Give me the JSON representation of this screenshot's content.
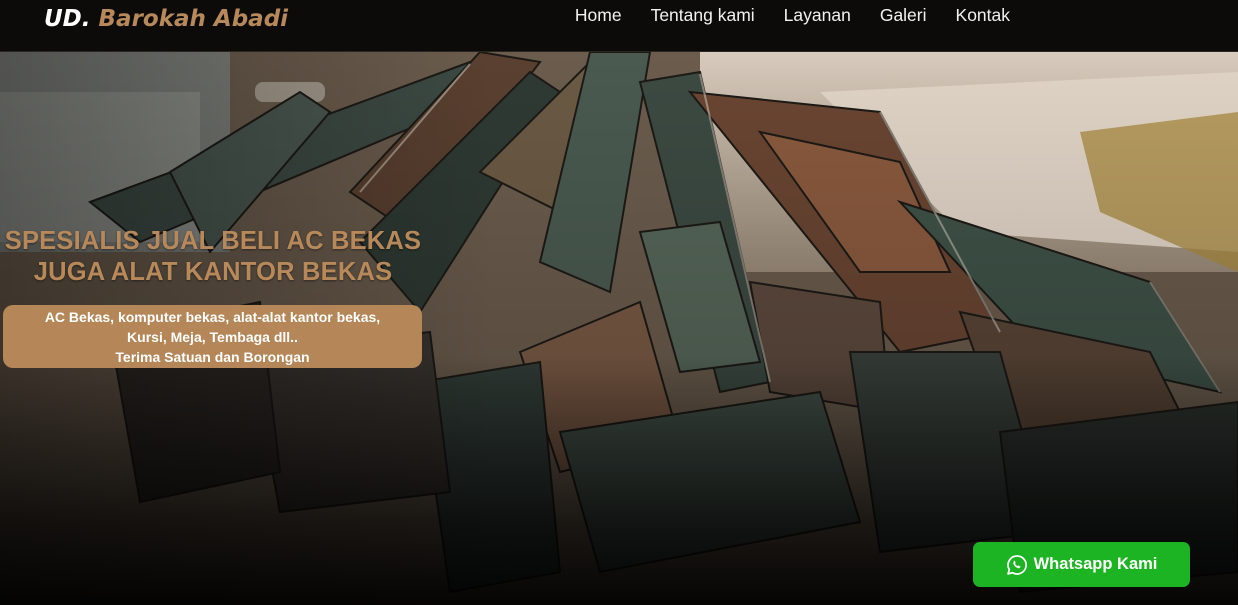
{
  "brand": {
    "prefix": "UD.",
    "name": "Barokah Abadi"
  },
  "nav": {
    "items": [
      {
        "label": "Home"
      },
      {
        "label": "Tentang kami"
      },
      {
        "label": "Layanan"
      },
      {
        "label": "Galeri"
      },
      {
        "label": "Kontak"
      }
    ]
  },
  "hero": {
    "headline_line1": "SPESIALIS JUAL BELI AC BEKAS",
    "headline_line2": "JUGA ALAT KANTOR BEKAS",
    "tagline_line1": "AC Bekas, komputer bekas, alat-alat kantor bekas,",
    "tagline_line2": "Kursi, Meja, Tembaga dll..",
    "tagline_line3": "Terima Satuan dan Borongan"
  },
  "whatsapp": {
    "label": "Whatsapp Kami",
    "icon": "whatsapp-icon"
  },
  "colors": {
    "accent": "#b7895a",
    "tagline_bg": "#b58758",
    "whatsapp": "#1db424",
    "header_bg": "#0c0b0a"
  }
}
